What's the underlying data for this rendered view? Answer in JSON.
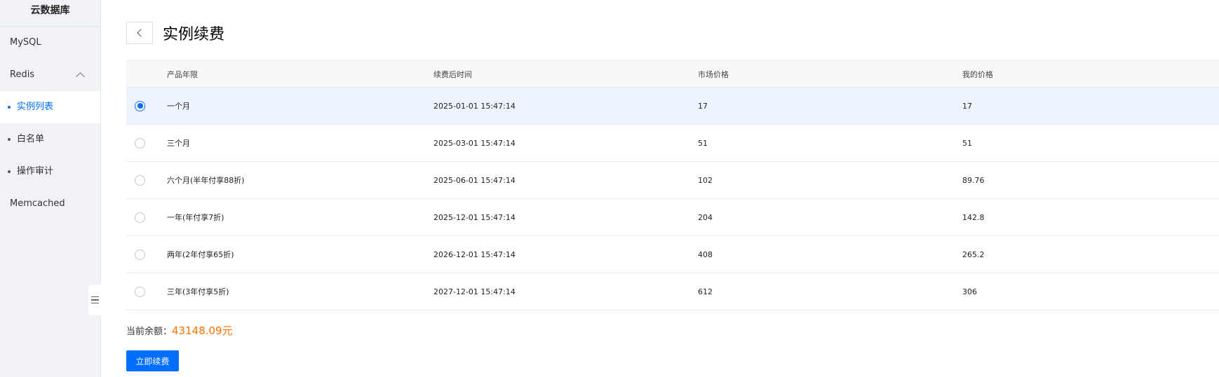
{
  "sidebar": {
    "title": "云数据库",
    "items": [
      {
        "label": "MySQL"
      },
      {
        "label": "Redis"
      },
      {
        "label": "Memcached"
      }
    ],
    "sub_items": [
      {
        "label": "实例列表",
        "active": true
      },
      {
        "label": "白名单",
        "active": false
      },
      {
        "label": "操作审计",
        "active": false
      }
    ]
  },
  "header": {
    "title": "实例续费"
  },
  "table": {
    "columns": [
      "产品年限",
      "续费后时间",
      "市场价格",
      "我的价格"
    ],
    "rows": [
      {
        "period": "一个月",
        "renew_time": "2025-01-01 15:47:14",
        "market_price": "17",
        "my_price": "17",
        "selected": true
      },
      {
        "period": "三个月",
        "renew_time": "2025-03-01 15:47:14",
        "market_price": "51",
        "my_price": "51",
        "selected": false
      },
      {
        "period": "六个月(半年付享88折)",
        "renew_time": "2025-06-01 15:47:14",
        "market_price": "102",
        "my_price": "89.76",
        "selected": false
      },
      {
        "period": "一年(年付享7折)",
        "renew_time": "2025-12-01 15:47:14",
        "market_price": "204",
        "my_price": "142.8",
        "selected": false
      },
      {
        "period": "两年(2年付享65折)",
        "renew_time": "2026-12-01 15:47:14",
        "market_price": "408",
        "my_price": "265.2",
        "selected": false
      },
      {
        "period": "三年(3年付享5折)",
        "renew_time": "2027-12-01 15:47:14",
        "market_price": "612",
        "my_price": "306",
        "selected": false
      }
    ]
  },
  "balance": {
    "label": "当前余额：",
    "value": "43148.09元"
  },
  "actions": {
    "renew_label": "立即续费"
  },
  "colors": {
    "accent": "#006eff",
    "balance": "#ff7200",
    "selected_row": "#eef4fd"
  }
}
